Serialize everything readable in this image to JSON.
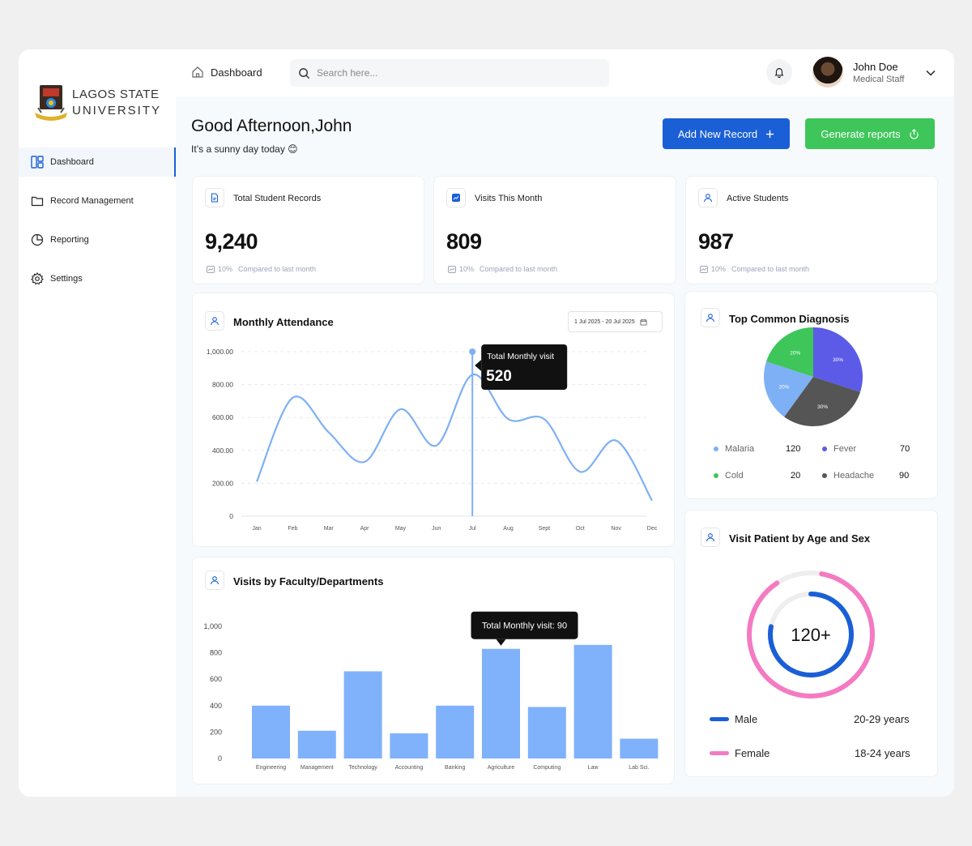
{
  "sidebar": {
    "logo": {
      "line1": "LAGOS STATE",
      "line2": "UNIVERSITY"
    },
    "items": [
      {
        "label": "Dashboard",
        "icon": "layout-icon",
        "active": true
      },
      {
        "label": "Record Management",
        "icon": "folder-icon",
        "active": false
      },
      {
        "label": "Reporting",
        "icon": "pie-chart-icon",
        "active": false
      },
      {
        "label": "Settings",
        "icon": "gear-icon",
        "active": false
      }
    ]
  },
  "header": {
    "breadcrumb": "Dashboard",
    "search_placeholder": "Search here...",
    "user": {
      "name": "John Doe",
      "role": "Medical Staff"
    }
  },
  "greeting": {
    "title": "Good Afternoon,John",
    "subtitle": "It’s a sunny day today 😊"
  },
  "actions": {
    "add_record": "Add New Record",
    "generate_reports": "Generate reports"
  },
  "stats": [
    {
      "title": "Total Student Records",
      "value": "9,240",
      "change": "10%",
      "compare": "Compared to last month"
    },
    {
      "title": "Visits This Month",
      "value": "809",
      "change": "10%",
      "compare": "Compared to last month"
    },
    {
      "title": "Active Students",
      "value": "987",
      "change": "10%",
      "compare": "Compared to last month"
    }
  ],
  "attendance": {
    "title": "Monthly Attendance",
    "date_range": "1 Jul 2025 - 20 Jul 2025",
    "tooltip_label": "Total Monthly visit",
    "tooltip_value": "520"
  },
  "faculty": {
    "title": "Visits by Faculty/Departments",
    "tooltip": "Total Monthly visit: 90"
  },
  "diagnosis": {
    "title": "Top Common Diagnosis",
    "legend": [
      {
        "label": "Malaria",
        "value": "120",
        "color": "#7eb0f5"
      },
      {
        "label": "Fever",
        "value": "70",
        "color": "#5b5be8"
      },
      {
        "label": "Cold",
        "value": "20",
        "color": "#3ec65a"
      },
      {
        "label": "Headache",
        "value": "90",
        "color": "#555555"
      }
    ]
  },
  "age_sex": {
    "title": "Visit Patient by Age and Sex",
    "center": "120+",
    "rows": [
      {
        "label": "Male",
        "range": "20-29 years",
        "color": "#1a5fd6"
      },
      {
        "label": "Female",
        "range": "18-24 years",
        "color": "#f47ac2"
      }
    ]
  },
  "chart_data": [
    {
      "type": "line",
      "title": "Monthly Attendance",
      "categories": [
        "Jan",
        "Feb",
        "Mar",
        "Apr",
        "May",
        "Jun",
        "Jul",
        "Aug",
        "Sept",
        "Oct",
        "Nov",
        "Dec"
      ],
      "values": [
        210,
        720,
        510,
        330,
        650,
        430,
        860,
        590,
        590,
        270,
        460,
        95
      ],
      "ylim": [
        0,
        1000
      ],
      "yticks": [
        "0",
        "200.00",
        "400.00",
        "600.00",
        "800.00",
        "1,000.00"
      ],
      "grid": true,
      "color": "#7eb0f5"
    },
    {
      "type": "bar",
      "title": "Visits by Faculty/Departments",
      "categories": [
        "Engineering",
        "Management",
        "Technology",
        "Accounting",
        "Banking",
        "Agriculture",
        "Computing",
        "Law",
        "Lab Sci."
      ],
      "values": [
        400,
        210,
        660,
        190,
        400,
        830,
        390,
        860,
        150
      ],
      "ylim": [
        0,
        1000
      ],
      "yticks": [
        "0",
        "200",
        "400",
        "600",
        "800",
        "1,000"
      ],
      "color": "#80b1fb"
    },
    {
      "type": "pie",
      "title": "Top Common Diagnosis",
      "slices": [
        {
          "label": "Fever",
          "pct": 30,
          "text": "30%",
          "color": "#5b5be8"
        },
        {
          "label": "Headache",
          "pct": 30,
          "text": "30%",
          "color": "#555555"
        },
        {
          "label": "Malaria",
          "pct": 20,
          "text": "20%",
          "color": "#7eb0f5"
        },
        {
          "label": "Cold",
          "pct": 20,
          "text": "20%",
          "color": "#3ec65a"
        }
      ]
    }
  ]
}
